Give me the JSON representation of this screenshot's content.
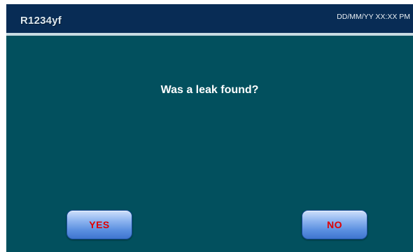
{
  "header": {
    "title": "R1234yf",
    "datetime": "DD/MM/YY XX:XX PM"
  },
  "prompt": {
    "question": "Was a leak found?"
  },
  "actions": {
    "yes_label": "YES",
    "no_label": "NO"
  },
  "colors": {
    "background": "#02505e",
    "header": "#082c55",
    "button_text": "#e00000"
  }
}
